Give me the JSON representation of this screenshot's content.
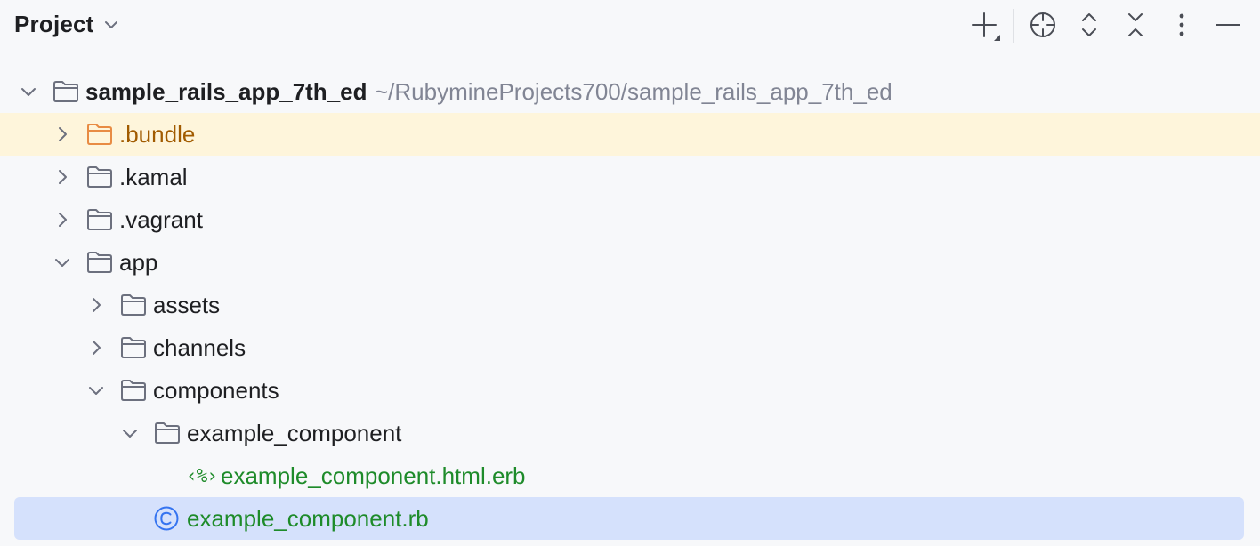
{
  "panel": {
    "title": "Project"
  },
  "toolbar": {
    "buttons": [
      "new-file",
      "locate",
      "expand-all",
      "collapse-all",
      "options",
      "hide"
    ]
  },
  "colors": {
    "background": "#F7F8FA",
    "highlight_row": "#FEF5DB",
    "selected_row": "#D5E1FC",
    "text": "#1E1F22",
    "muted_path": "#818594",
    "excluded_orange": "#A15B00",
    "excluded_folder": "#E88B43",
    "vcs_new_green": "#1E8B2A",
    "class_icon_blue": "#3574F0"
  },
  "tree": {
    "root": {
      "label": "sample_rails_app_7th_ed",
      "path": "~/RubymineProjects700/sample_rails_app_7th_ed",
      "icon": "folder-icon",
      "expanded": true
    },
    "items": [
      {
        "label": ".bundle",
        "icon": "folder-icon",
        "expanded": false
      },
      {
        "label": ".kamal",
        "icon": "folder-icon",
        "expanded": false
      },
      {
        "label": ".vagrant",
        "icon": "folder-icon",
        "expanded": false
      },
      {
        "label": "app",
        "icon": "folder-icon",
        "expanded": true
      },
      {
        "label": "assets",
        "icon": "folder-icon",
        "expanded": false
      },
      {
        "label": "channels",
        "icon": "folder-icon",
        "expanded": false
      },
      {
        "label": "components",
        "icon": "folder-icon",
        "expanded": true
      },
      {
        "label": "example_component",
        "icon": "folder-icon",
        "expanded": true
      },
      {
        "label": "example_component.html.erb",
        "icon": "erb-icon",
        "icon_text": "‹%›"
      },
      {
        "label": "example_component.rb",
        "icon": "ruby-class-icon"
      }
    ]
  }
}
